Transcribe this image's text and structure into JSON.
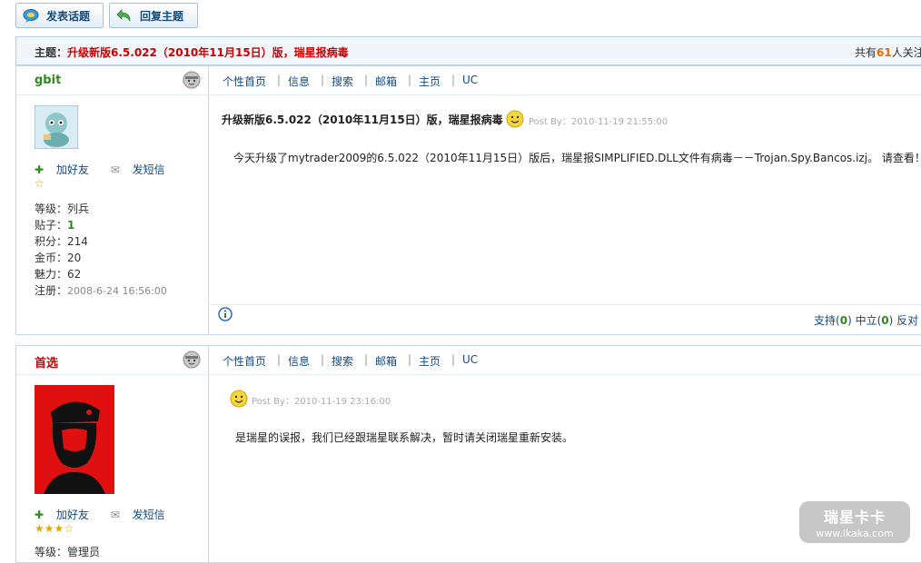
{
  "toolbar": {
    "new_topic": "发表话题",
    "reply": "回复主题"
  },
  "topic": {
    "prefix": "主题：",
    "title": "升级新版6.5.022（2010年11月15日）版，瑞星报病毒",
    "count_prefix": "共有",
    "count_value": "61",
    "count_suffix": "人关注"
  },
  "nav_links": [
    "个性首页",
    "信息",
    "搜索",
    "邮箱",
    "主页",
    "UC"
  ],
  "posts": [
    {
      "username": "gbit",
      "add_friend": "加好友",
      "send_msg": "发短信",
      "stars": "☆",
      "level": "等级：列兵",
      "posts_label": "贴子：",
      "posts_value": "1",
      "points": "积分：214",
      "gold": "金币：20",
      "charm": "魅力：62",
      "reg_label": "注册：",
      "reg_value": "2008-6-24 16:56:00",
      "title": "升级新版6.5.022（2010年11月15日）版，瑞星报病毒",
      "post_by": "Post By：2010-11-19 21:55:00",
      "content": "今天升级了mytrader2009的6.5.022（2010年11月15日）版后，瑞星报SIMPLIFIED.DLL文件有病毒－－Trojan.Spy.Bancos.izj。  请查看！",
      "vote_support": "支持",
      "vote_support_n": "0",
      "vote_neutral": "中立",
      "vote_neutral_n": "0",
      "vote_oppose": "反对"
    },
    {
      "username": "首选",
      "add_friend": "加好友",
      "send_msg": "发短信",
      "stars": "★★★☆",
      "partial_label": "等级：管理员",
      "post_by": "Post By：2010-11-19 23:16:00",
      "content": "是瑞星的误报，我们已经跟瑞星联系解决，暂时请关闭瑞星重新安装。"
    }
  ],
  "watermark": {
    "brand": "瑞星卡卡",
    "url": "www.ikaka.com"
  },
  "colors": {
    "accent_blue": "#124a7e",
    "title_red": "#cc0000",
    "count_orange": "#e36c09",
    "name_green": "#2f8a1f"
  }
}
